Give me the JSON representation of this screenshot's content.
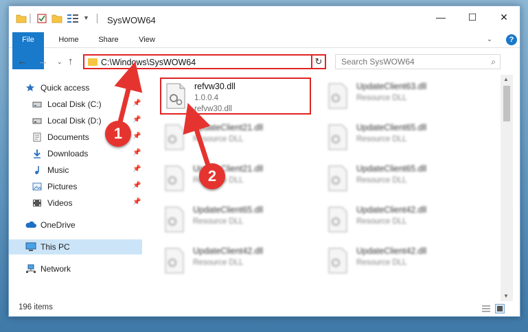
{
  "window": {
    "title": "SysWOW64",
    "controls": {
      "minimize": "—",
      "maximize": "☐",
      "close": "✕"
    }
  },
  "ribbon": {
    "tabs": [
      "File",
      "Home",
      "Share",
      "View"
    ],
    "help_icon": "?"
  },
  "address": {
    "path": "C:\\Windows\\SysWOW64",
    "search_placeholder": "Search SysWOW64"
  },
  "sidebar": {
    "items": [
      {
        "label": "Quick access",
        "icon": "star-icon"
      },
      {
        "label": "Local Disk (C:)",
        "icon": "drive-icon",
        "pinned": true
      },
      {
        "label": "Local Disk (D:)",
        "icon": "drive-icon",
        "pinned": true
      },
      {
        "label": "Documents",
        "icon": "documents-icon",
        "pinned": true
      },
      {
        "label": "Downloads",
        "icon": "download-icon",
        "pinned": true
      },
      {
        "label": "Music",
        "icon": "music-icon",
        "pinned": true
      },
      {
        "label": "Pictures",
        "icon": "pictures-icon",
        "pinned": true
      },
      {
        "label": "Videos",
        "icon": "videos-icon",
        "pinned": true
      },
      {
        "label": "OneDrive",
        "icon": "cloud-icon"
      },
      {
        "label": "This PC",
        "icon": "computer-icon",
        "selected": true
      },
      {
        "label": "Network",
        "icon": "network-icon"
      }
    ]
  },
  "files": [
    {
      "name": "refvw30.dll",
      "version": "1.0.0.4",
      "desc": "refvw30.dll"
    },
    {
      "name": "UpdateClient63.dll",
      "version": "",
      "desc": "Resource DLL"
    },
    {
      "name": "UpdateClient21.dll",
      "version": "",
      "desc": "Resource DLL"
    },
    {
      "name": "UpdateClient65.dll",
      "version": "",
      "desc": "Resource DLL"
    },
    {
      "name": "UpdateClient21.dll",
      "version": "",
      "desc": "Resource DLL"
    },
    {
      "name": "UpdateClient65.dll",
      "version": "",
      "desc": "Resource DLL"
    },
    {
      "name": "UpdateClient65.dll",
      "version": "",
      "desc": "Resource DLL"
    },
    {
      "name": "UpdateClient42.dll",
      "version": "",
      "desc": "Resource DLL"
    },
    {
      "name": "UpdateClient42.dll",
      "version": "",
      "desc": "Resource DLL"
    },
    {
      "name": "UpdateClient42.dll",
      "version": "",
      "desc": "Resource DLL"
    }
  ],
  "status": {
    "item_count": "196 items"
  },
  "callouts": [
    "1",
    "2"
  ],
  "colors": {
    "accent": "#1979ca",
    "highlight": "#e02323",
    "callout": "#e5342f",
    "selected_bg": "#cce4f7",
    "folder": "#f6c544"
  }
}
